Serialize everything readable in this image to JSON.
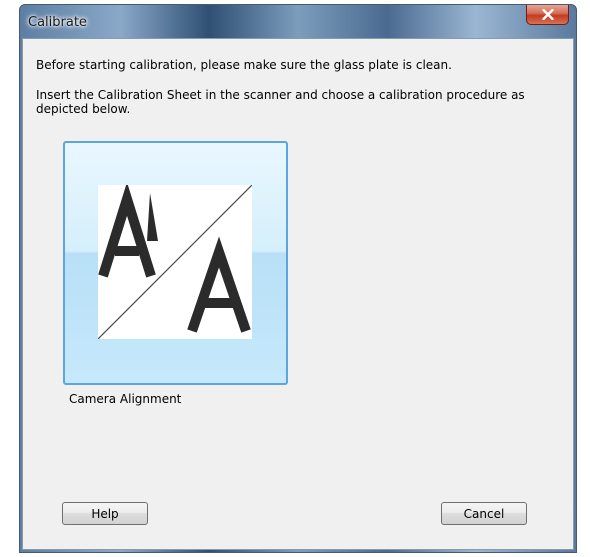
{
  "window": {
    "title": "Calibrate"
  },
  "messages": {
    "line1": "Before starting calibration, please make sure the glass plate is clean.",
    "line2": "Insert the Calibration Sheet in the scanner and choose a calibration procedure as depicted below."
  },
  "procedures": [
    {
      "label": "Camera Alignment",
      "icon": "camera-alignment-icon",
      "selected": true
    }
  ],
  "buttons": {
    "help": "Help",
    "cancel": "Cancel"
  },
  "colors": {
    "tile_border": "#5ba6e0",
    "tile_fill": "#c6e8fb",
    "dialog_bg": "#f0f0f0",
    "close_button": "#c33a1f"
  }
}
